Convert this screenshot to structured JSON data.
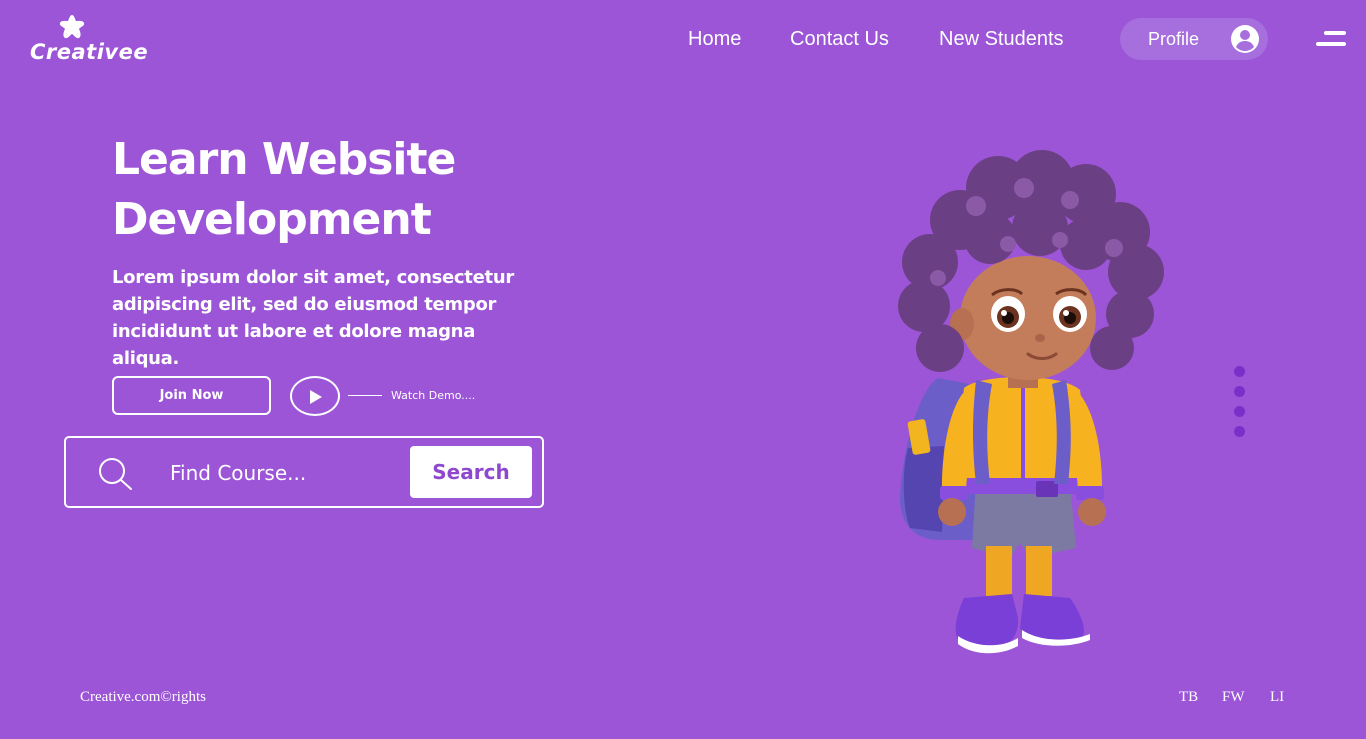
{
  "brand": {
    "name": "Creativee"
  },
  "nav": {
    "links": [
      "Home",
      "Contact Us",
      "New Students"
    ],
    "profile_label": "Profile"
  },
  "hero": {
    "title": "Learn Website Development",
    "description": "Lorem ipsum dolor sit amet, consectetur adipiscing elit, sed do eiusmod tempor incididunt ut labore et dolore magna aliqua.",
    "join_label": "Join Now",
    "watch_label": "Watch Demo...."
  },
  "search": {
    "placeholder": "Find Course...",
    "button_label": "Search"
  },
  "footer": {
    "copyright": "Creative.com©rights",
    "social": [
      "TB",
      "FW",
      "LI"
    ]
  },
  "colors": {
    "background": "#9b55d6",
    "accent": "#8e48cf",
    "dots": "#7b2fc9"
  },
  "icons": [
    "star-icon",
    "user-circle-icon",
    "menu-icon",
    "play-icon",
    "search-icon"
  ]
}
